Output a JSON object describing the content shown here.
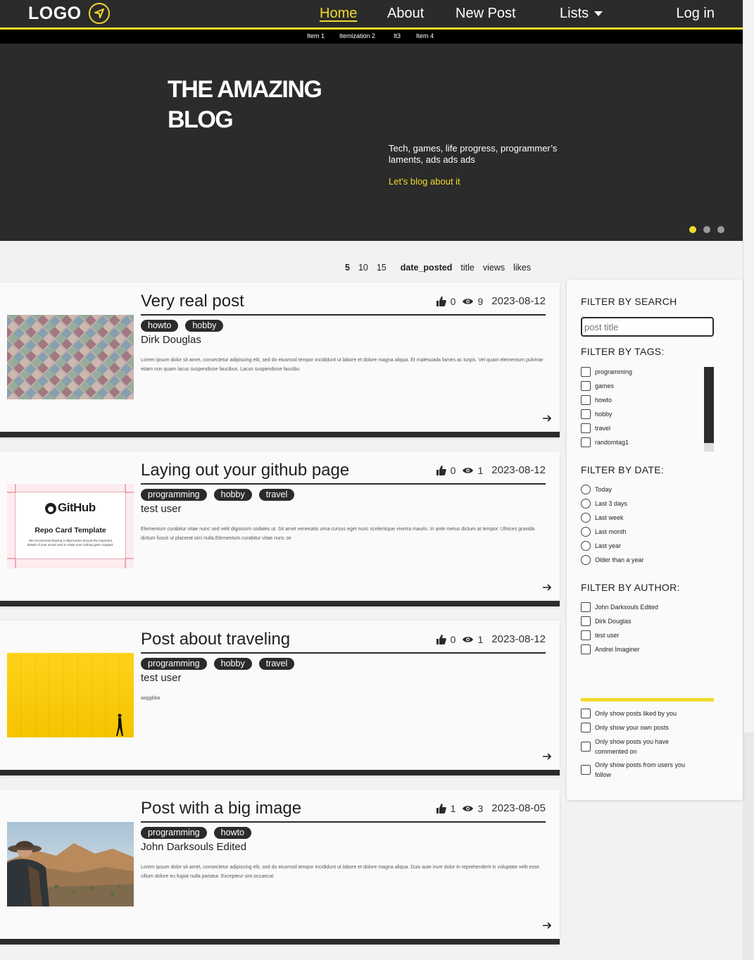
{
  "nav": {
    "logo": "LOGO",
    "links": [
      "Home",
      "About",
      "New Post",
      "Lists"
    ],
    "login": "Log in",
    "subitems": [
      "Item 1",
      "Itemization 2",
      "It3",
      "Item 4"
    ]
  },
  "hero": {
    "title": "THE AMAZING BLOG",
    "description": "Tech, games, life progress, programmer’s laments, ads ads ads",
    "cta": "Let’s blog about it",
    "slides": 3,
    "active_slide": 1
  },
  "sort": {
    "page_sizes": [
      "5",
      "10",
      "15"
    ],
    "fields": [
      "date_posted",
      "title",
      "views",
      "likes"
    ]
  },
  "posts": [
    {
      "title": "Very real post",
      "likes": "0",
      "views": "9",
      "date": "2023-08-12",
      "tags": [
        "howto",
        "hobby"
      ],
      "author": "Dirk Douglas",
      "excerpt": "Lorem ipsum dolor sit amet, consectetur adipiscing elit, sed do eiusmod tempor incididunt ut labore et dolore magna aliqua. Et malesuada fames ac turpis. Vel quam elementum pulvinar etiam non quam lacus suspendisse faucibus. Lacus suspendisse faucibu",
      "image": "tiles"
    },
    {
      "title": "Laying out your github page",
      "likes": "0",
      "views": "1",
      "date": "2023-08-12",
      "tags": [
        "programming",
        "hobby",
        "travel"
      ],
      "author": "test user",
      "excerpt": "Elementum curabitur vitae nunc sed velit dignissim sodales ut. Sit amet venenatis urna cursus eget nunc scelerisque viverra mauris. In ante metus dictum at tempor. Ultrices gravida dictum fusce ut placerat orci nulla.Elementum curabitur vitae nunc se",
      "image": "github",
      "image_text": {
        "brand": "GitHub",
        "heading": "Repo Card Template",
        "caption": "We recommend leaving a 40pt border around the important details of your social card to make sure nothing gets cropped."
      }
    },
    {
      "title": "Post about traveling",
      "likes": "0",
      "views": "1",
      "date": "2023-08-12",
      "tags": [
        "programming",
        "hobby",
        "travel"
      ],
      "author": "test user",
      "excerpt": "aaggbba",
      "image": "yellow-wall"
    },
    {
      "title": "Post with a big image",
      "likes": "1",
      "views": "3",
      "date": "2023-08-05",
      "tags": [
        "programming",
        "howto"
      ],
      "author": "John Darksouls Edited",
      "excerpt": "Lorem ipsum dolor sit amet, consectetur adipiscing elit, sed do eiusmod tempor incididunt ut labore et dolore magna aliqua. Duis aute irure dolor in reprehenderit in voluptate velit esse cillum dolore eu fugiat nulla pariatur. Excepteur sint occaecat",
      "image": "desert"
    }
  ],
  "filter": {
    "search_heading": "FILTER BY SEARCH",
    "search_placeholder": "post title",
    "tags_heading": "FILTER BY TAGS:",
    "tags": [
      "programming",
      "games",
      "howto",
      "hobby",
      "travel",
      "randomtag1"
    ],
    "date_heading": "FILTER BY DATE:",
    "dates": [
      "Today",
      "Last 3 days",
      "Last week",
      "Last month",
      "Last year",
      "Older than a year"
    ],
    "author_heading": "FILTER BY AUTHOR:",
    "authors": [
      "John Darksouls Edited",
      "Dirk Douglas",
      "test user",
      "Andrei Imaginer"
    ],
    "toggles": [
      "Only show posts liked by you",
      "Only show your own posts",
      "Only show posts you have commented on",
      "Only show posts from users you follow"
    ]
  },
  "colors": {
    "accent": "#f2da2c",
    "dark": "#2b2b2b",
    "card": "#fafafa"
  }
}
